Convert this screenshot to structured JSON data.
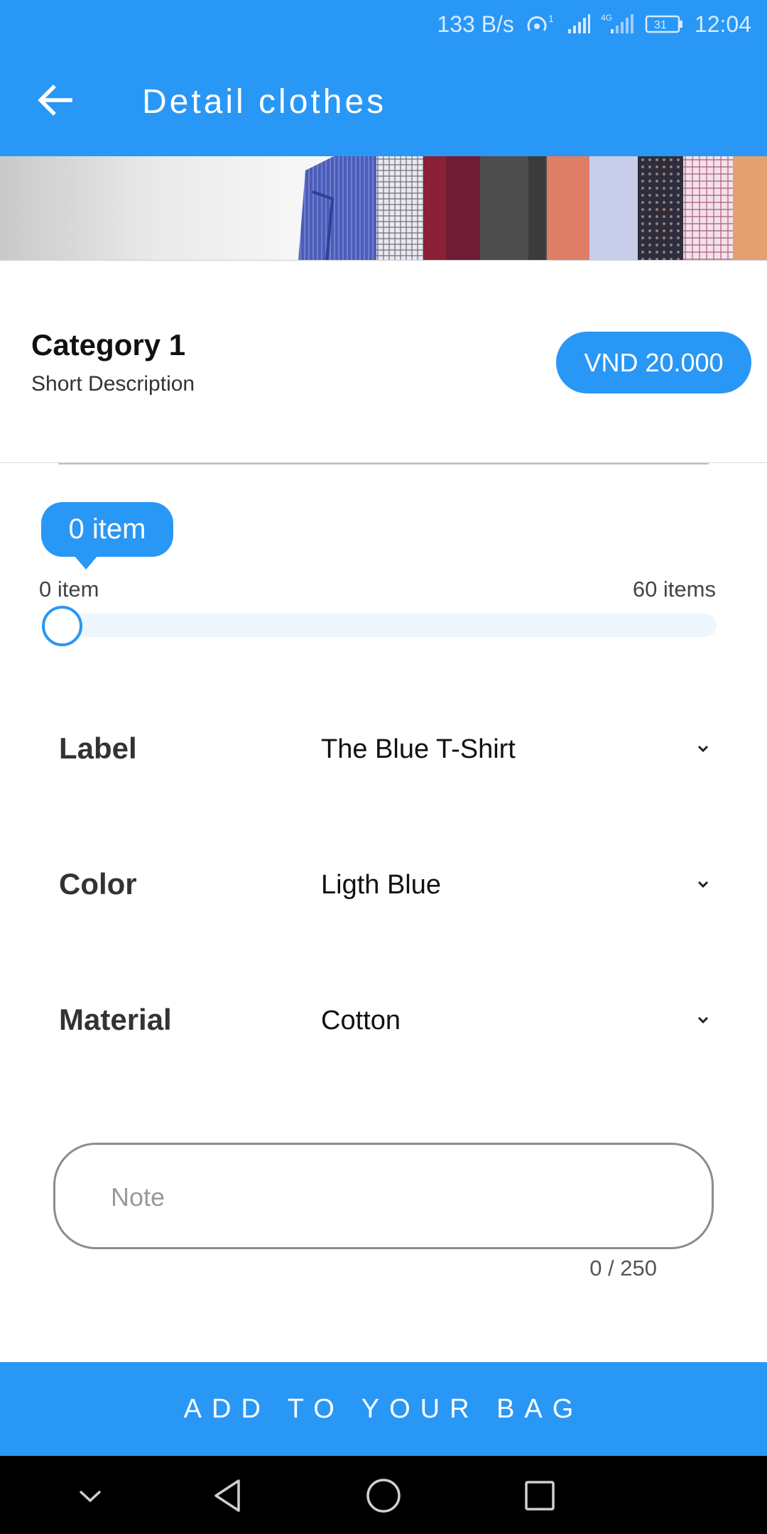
{
  "status_bar": {
    "network_speed": "133 B/s",
    "hotspot_sup": "1",
    "network_type": "4G",
    "battery": "31",
    "time": "12:04",
    "icons": [
      "hotspot-icon",
      "signal-icon",
      "signal-4g-icon",
      "battery-icon"
    ]
  },
  "app_bar": {
    "title": "Detail clothes",
    "back_icon": "arrow-left-icon",
    "color": "#2997f5"
  },
  "banner": {
    "image": "hanging-shirts-banner"
  },
  "product": {
    "category": "Category 1",
    "short_description": "Short Description",
    "price": "VND 20.000"
  },
  "quantity_slider": {
    "bubble": "0 item",
    "min_label": "0 item",
    "max_label": "60 items",
    "value": 0,
    "min": 0,
    "max": 60
  },
  "options": [
    {
      "label": "Label",
      "value": "The Blue T-Shirt"
    },
    {
      "label": "Color",
      "value": "Ligth Blue"
    },
    {
      "label": "Material",
      "value": "Cotton"
    }
  ],
  "note": {
    "placeholder": "Note",
    "counter": "0 / 250"
  },
  "cta": {
    "label": "ADD TO YOUR BAG"
  },
  "nav_bar": {
    "icons": [
      "chevron-down-icon",
      "back-triangle-icon",
      "home-circle-icon",
      "recents-square-icon"
    ]
  },
  "colors": {
    "primary": "#2997f5",
    "track": "#eef6fe",
    "navbar": "#000000"
  }
}
